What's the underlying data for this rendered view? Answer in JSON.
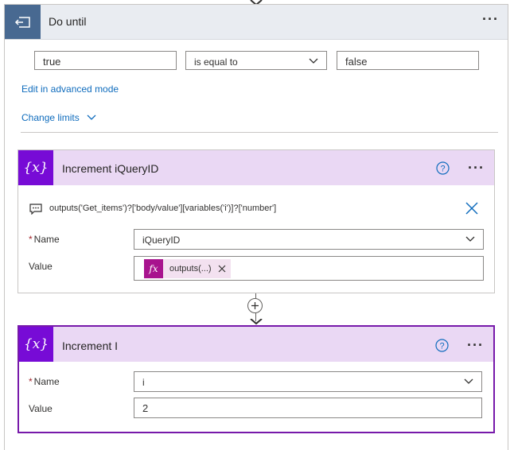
{
  "do_until": {
    "title": "Do until",
    "condition_left": "true",
    "operator": "is equal to",
    "condition_right": "false",
    "edit_advanced_link": "Edit in advanced mode",
    "change_limits_link": "Change limits"
  },
  "increment_iqueryid": {
    "title": "Increment iQueryID",
    "expression": "outputs('Get_items')?['body/value'][variables('i')]?['number']",
    "name_label": "Name",
    "name_value": "iQueryID",
    "value_label": "Value",
    "value_token": "outputs(...)"
  },
  "increment_i": {
    "title": "Increment I",
    "name_label": "Name",
    "name_value": "i",
    "value_label": "Value",
    "value_value": "2"
  },
  "required_marker": "*",
  "var_icon_glyph": "{x}",
  "fx_glyph": "fx",
  "colors": {
    "do_until_header": "#e9ecf1",
    "do_until_icon": "#486991",
    "variable_header": "#ead8f4",
    "variable_icon": "#770bd6",
    "selected_border": "#7719aa",
    "link": "#0f6cbd",
    "fx_token": "#a8138e"
  }
}
